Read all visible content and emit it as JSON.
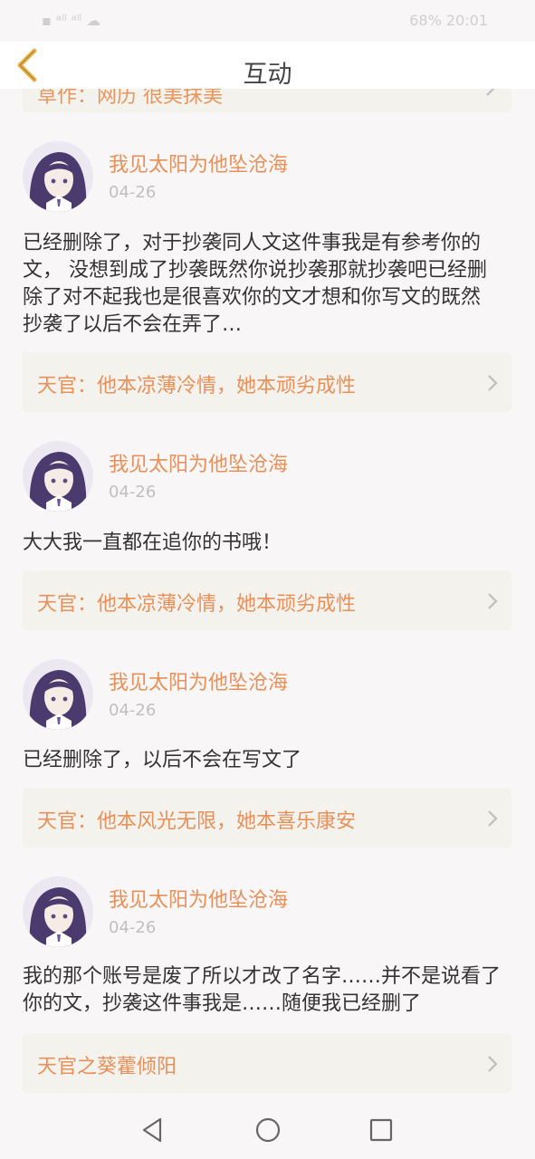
{
  "status_bar": {
    "left": "▪ ᵃˡˡ ᵃˡˡ ☁",
    "right": "68% 20:01"
  },
  "header": {
    "title": "互动"
  },
  "partial_top": {
    "text": "草作：网历 很美抹美"
  },
  "comments": [
    {
      "username": "我见太阳为他坠沧海",
      "date": "04-26",
      "text": "已经删除了，对于抄袭同人文这件事我是有参考你的\n文， 没想到成了抄袭既然你说抄袭那就抄袭吧已经删\n除了对不起我也是很喜欢你的文才想和你写文的既然\n抄袭了以后不会在弄了…",
      "book": "天官：他本凉薄冷情，她本顽劣成性"
    },
    {
      "username": "我见太阳为他坠沧海",
      "date": "04-26",
      "text": "大大我一直都在追你的书哦！",
      "book": "天官：他本凉薄冷情，她本顽劣成性"
    },
    {
      "username": "我见太阳为他坠沧海",
      "date": "04-26",
      "text": "已经删除了，以后不会在写文了",
      "book": "天官：他本风光无限，她本喜乐康安"
    },
    {
      "username": "我见太阳为他坠沧海",
      "date": "04-26",
      "text": "我的那个账号是废了所以才改了名字……并不是说看了\n你的文，抄袭这件事我是……随便我已经删了",
      "book": "天官之葵藿倾阳"
    }
  ],
  "colors": {
    "accent": "#e8905a",
    "card_bg": "#f4f2ec",
    "page_bg": "#f8f6f6",
    "back_icon": "#e8b64a"
  },
  "icons": {
    "back": "chevron-left-icon",
    "chevron": "chevron-right-icon",
    "nav_back": "triangle-back-icon",
    "nav_home": "circle-home-icon",
    "nav_recent": "square-recent-icon"
  }
}
